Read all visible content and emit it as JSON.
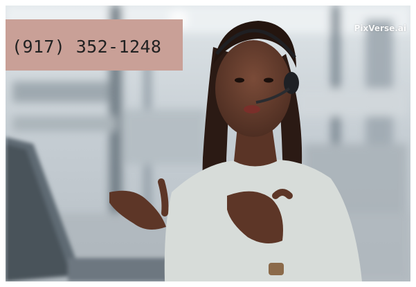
{
  "overlay": {
    "phone_number": "(917) 352-1248",
    "background_color": "#c9a097"
  },
  "watermark": {
    "text": "PixVerse.ai"
  },
  "photo": {
    "subject": "woman with headset gesturing at laptop in office"
  }
}
